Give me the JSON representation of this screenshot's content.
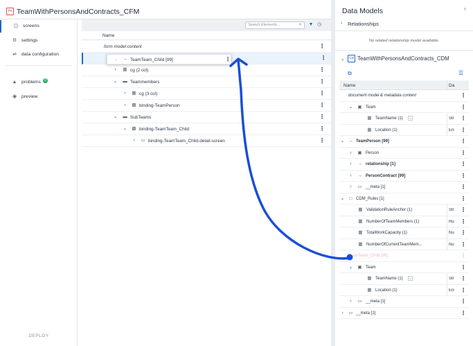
{
  "app": {
    "title": "TeamWithPersonsAndContracts_CFM",
    "icon_label": "fm"
  },
  "sidebar": {
    "items": [
      {
        "label": "screens",
        "icon": "screens-icon",
        "active": true
      },
      {
        "label": "settings",
        "icon": "gear-icon"
      },
      {
        "label": "data configuration",
        "icon": "transfer-icon"
      },
      {
        "label": "problems",
        "icon": "warning-icon",
        "badge": "0"
      },
      {
        "label": "preview",
        "icon": "eye-icon"
      }
    ],
    "deploy": "DEPLOY"
  },
  "toolbar": {
    "search_placeholder": "Search Elements..."
  },
  "table": {
    "name_header": "Name",
    "rows": [
      {
        "label": "form model content"
      },
      {
        "label": "TeamTeam_Child [99]"
      },
      {
        "label": "cg (2 col)"
      },
      {
        "label": "Teammembers"
      },
      {
        "label": "cg (3 col)"
      },
      {
        "label": "binding-TeamPerson"
      },
      {
        "label": "SubTeams"
      },
      {
        "label": "binding-TeamTeam_Child"
      },
      {
        "label": "binding-TeamTeam_Child-detail-screen"
      }
    ]
  },
  "right_panel": {
    "title": "Data Models",
    "relationships_label": "Relationships",
    "no_relationship": "No related relationship model available.",
    "cdm_title": "TeamWithPersonsAndContracts_CDM",
    "cdm_icon_label": "Cd",
    "col_name": "Name",
    "col_type": "Da",
    "rows": [
      {
        "label": "document model & metadata content",
        "type": ""
      },
      {
        "label": "Team",
        "type": ""
      },
      {
        "label": "TeamName (1)",
        "type": "Stri"
      },
      {
        "label": "Location (1)",
        "type": "Enu"
      },
      {
        "label": "TeamPerson [99]",
        "type": ""
      },
      {
        "label": "Person",
        "type": ""
      },
      {
        "label": "relationship [1]",
        "type": ""
      },
      {
        "label": "PersonContract [99]",
        "type": ""
      },
      {
        "label": "__meta [1]",
        "type": ""
      },
      {
        "label": "CDM_Rules [1]",
        "type": ""
      },
      {
        "label": "ValidationRuleAnchor (1)",
        "type": "Stri"
      },
      {
        "label": "NumberOfTeamMembers (1)",
        "type": "Nu"
      },
      {
        "label": "TotalWorkCapacity (1)",
        "type": "Nu"
      },
      {
        "label": "NumberOfCurrentTeamMem...",
        "type": "Nu"
      },
      {
        "label": "TeamTeam_Child [99]",
        "type": ""
      },
      {
        "label": "Team",
        "type": ""
      },
      {
        "label": "TeamName (1)",
        "type": "Stri"
      },
      {
        "label": "Location (1)",
        "type": "Enu"
      },
      {
        "label": "__meta [1]",
        "type": ""
      },
      {
        "label": "__meta [1]",
        "type": ""
      }
    ]
  },
  "colors": {
    "accent": "#1668c9",
    "annotation": "#1a4fd6",
    "ghost_text": "#f3b8c4"
  }
}
